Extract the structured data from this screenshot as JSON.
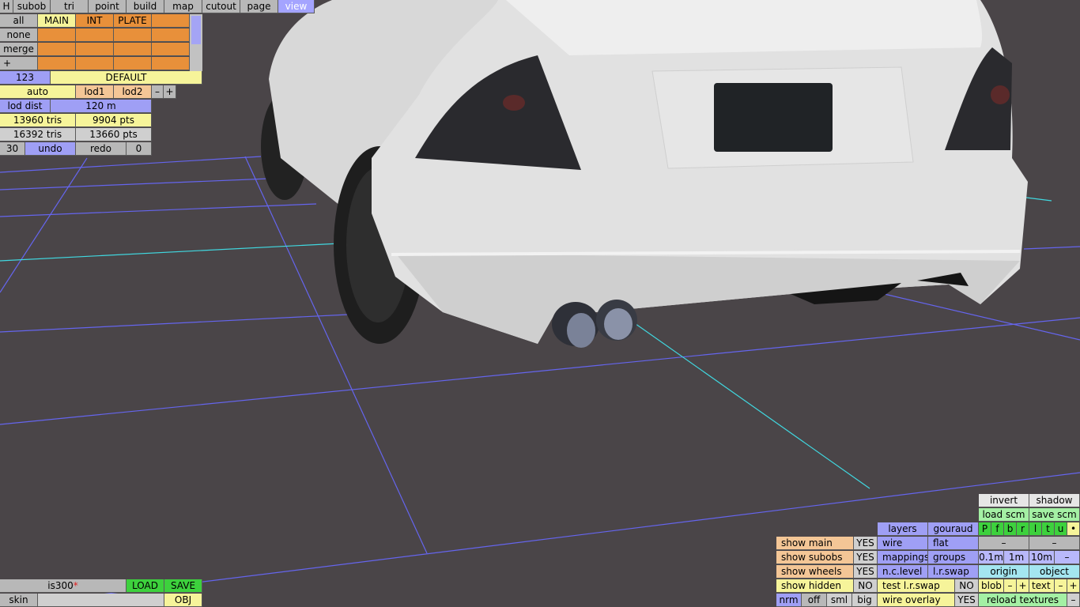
{
  "menu": {
    "h_label": "H",
    "items": [
      "subob",
      "tri",
      "point",
      "build",
      "map",
      "cutout",
      "page",
      "view"
    ],
    "active": "view"
  },
  "layer_table": {
    "rows": [
      "all",
      "none",
      "merge",
      "+"
    ],
    "columns": [
      "MAIN",
      "INT",
      "PLATE",
      ""
    ]
  },
  "object": {
    "number": "123",
    "name": "DEFAULT"
  },
  "lod": {
    "auto": "auto",
    "lod1": "lod1",
    "lod2": "lod2",
    "minus": "–",
    "plus": "+",
    "dist_label": "lod dist",
    "dist_value": "120 m"
  },
  "stats": {
    "tris1": "13960 tris",
    "pts1": "9904 pts",
    "tris2": "16392 tris",
    "pts2": "13660 pts"
  },
  "history": {
    "count": "30",
    "undo": "undo",
    "redo": "redo",
    "redo_count": "0"
  },
  "file": {
    "name": "is300",
    "modified_mark": "*",
    "load": "LOAD",
    "save": "SAVE",
    "skin_label": "skin",
    "skin_value": "",
    "obj": "OBJ"
  },
  "right_panel": {
    "invert": "invert",
    "shadow": "shadow",
    "load_scm": "load scm",
    "save_scm": "save scm",
    "flags": [
      "P",
      "f",
      "b",
      "r",
      "l",
      "t",
      "u",
      "•"
    ],
    "layers": "layers",
    "gouraud": "gouraud",
    "wire": "wire",
    "flat": "flat",
    "dash1": "–",
    "dash2": "–",
    "mappings": "mappings",
    "groups": "groups",
    "size_01": "0.1m",
    "size_1": "1m",
    "size_10": "10m",
    "size_minus": "–",
    "nclevel": "n.c.level",
    "lrswap": "l.r.swap",
    "origin": "origin",
    "object": "object",
    "test_lrswap": "test l.r.swap",
    "test_lrswap_val": "NO",
    "blob": "blob",
    "blob_minus": "–",
    "blob_plus": "+",
    "text": "text",
    "text_minus": "–",
    "text_plus": "+",
    "wire_overlay": "wire overlay",
    "wire_overlay_val": "YES",
    "reload_textures": "reload textures",
    "reload_minus": "–",
    "show_main": "show main",
    "show_main_val": "YES",
    "show_subobs": "show subobs",
    "show_subobs_val": "YES",
    "show_wheels": "show wheels",
    "show_wheels_val": "YES",
    "show_hidden": "show hidden",
    "show_hidden_val": "NO",
    "render_modes": [
      "nrm",
      "off",
      "sml",
      "big"
    ]
  },
  "colors": {
    "grid": "#6060e8",
    "axis": "#40d8e0",
    "background": "#4a4548",
    "car": "#dcdcdc"
  }
}
